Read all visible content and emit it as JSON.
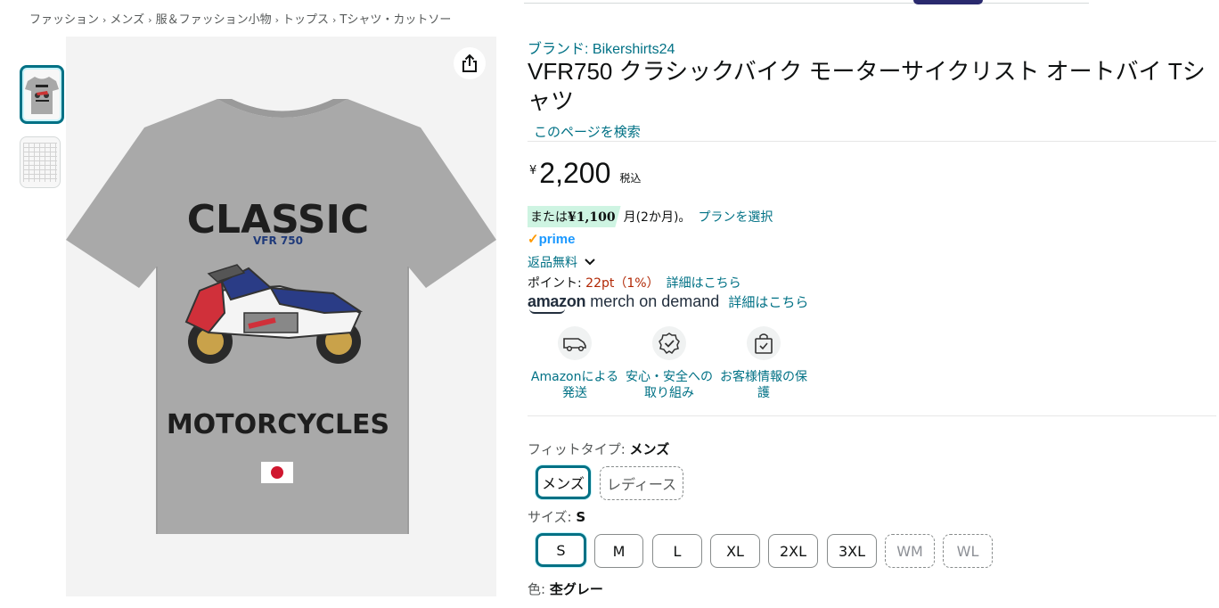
{
  "breadcrumb": [
    "ファッション",
    "メンズ",
    "服＆ファッション小物",
    "トップス",
    "Tシャツ・カットソー"
  ],
  "breadcrumb_sep": "›",
  "shirt_print": {
    "line1": "CLASSIC",
    "line2": "VFR 750",
    "line3": "MOTORCYCLES"
  },
  "product": {
    "brand": "ブランド: Bikershirts24",
    "title": "VFR750 クラシックバイク モーターサイクリスト オートバイ Tシャツ",
    "search_page": "このページを検索"
  },
  "price": {
    "symbol": "¥",
    "amount": "2,200",
    "tax": "税込"
  },
  "installment": {
    "prefix": "または",
    "amount": "¥1,100",
    "suffix": "月(2か月)。",
    "plan_link": "プランを選択"
  },
  "prime": {
    "check": "✓",
    "label": "prime"
  },
  "returns": {
    "label": "返品無料",
    "chevron": "⌄"
  },
  "points": {
    "label": "ポイント: ",
    "value": "22pt（1%）",
    "link": "詳細はこちら"
  },
  "merch": {
    "logo_bold": "amazon",
    "logo_text": " merch on demand",
    "link": "詳細はこちら"
  },
  "features": [
    {
      "label": "Amazonによる発送",
      "icon": "delivery-van-icon"
    },
    {
      "label": "安心・安全への取り組み",
      "icon": "security-badge-icon"
    },
    {
      "label": "お客様情報の保護",
      "icon": "secure-bag-icon"
    }
  ],
  "fit": {
    "label": "フィットタイプ: ",
    "selected": "メンズ",
    "options": [
      "メンズ",
      "レディース"
    ]
  },
  "size": {
    "label": "サイズ: ",
    "selected": "S",
    "options": [
      "S",
      "M",
      "L",
      "XL",
      "2XL",
      "3XL",
      "WM",
      "WL"
    ]
  },
  "color": {
    "label": "色: ",
    "selected": "杢グレー"
  },
  "colors": {
    "link": "#007185",
    "price_red": "#b12704",
    "prime_blue": "#1a98ff",
    "selected_border": "#007185",
    "shirt_gray": "#a9a9a9"
  }
}
